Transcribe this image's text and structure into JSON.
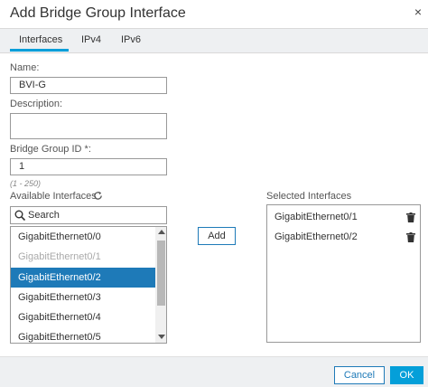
{
  "dialog": {
    "title": "Add Bridge Group Interface",
    "close_glyph": "×"
  },
  "tabs": [
    {
      "label": "Interfaces",
      "active": true
    },
    {
      "label": "IPv4",
      "active": false
    },
    {
      "label": "IPv6",
      "active": false
    }
  ],
  "form": {
    "name_label": "Name:",
    "name_value": "BVI-G",
    "description_label": "Description:",
    "description_value": "",
    "bridge_group_id_label": "Bridge Group ID *:",
    "bridge_group_id_value": "1",
    "bridge_group_id_hint": "(1 - 250)"
  },
  "available": {
    "label": "Available Interfaces",
    "refresh_icon": "refresh-icon",
    "search_placeholder": "Search",
    "items": [
      {
        "label": "GigabitEthernet0/0",
        "state": "normal"
      },
      {
        "label": "GigabitEthernet0/1",
        "state": "disabled"
      },
      {
        "label": "GigabitEthernet0/2",
        "state": "selected"
      },
      {
        "label": "GigabitEthernet0/3",
        "state": "normal"
      },
      {
        "label": "GigabitEthernet0/4",
        "state": "normal"
      },
      {
        "label": "GigabitEthernet0/5",
        "state": "normal"
      }
    ]
  },
  "add_button_label": "Add",
  "selected": {
    "label": "Selected Interfaces",
    "items": [
      {
        "label": "GigabitEthernet0/1",
        "icon": "trash-icon"
      },
      {
        "label": "GigabitEthernet0/2",
        "icon": "trash-icon"
      }
    ]
  },
  "footer": {
    "cancel_label": "Cancel",
    "ok_label": "OK"
  },
  "colors": {
    "accent": "#049fd9",
    "selection": "#1e7ab8"
  }
}
